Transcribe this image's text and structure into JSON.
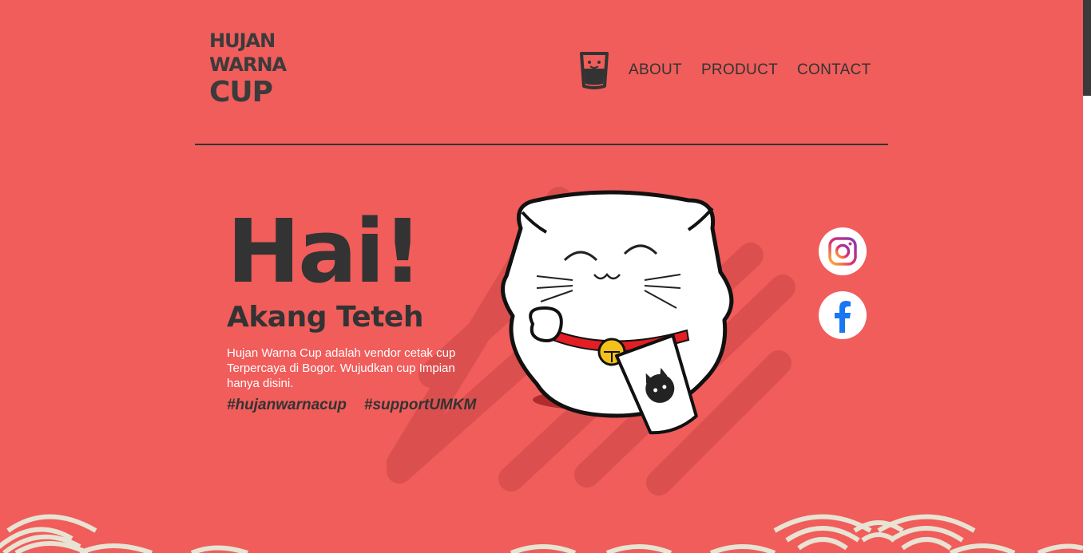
{
  "brand": {
    "logo_lines": [
      "HUJAN",
      "WARNA",
      "CUP"
    ],
    "logo_icon": "cup-icon"
  },
  "nav": {
    "icon": "cup-icon",
    "items": [
      {
        "label": "ABOUT"
      },
      {
        "label": "PRODUCT"
      },
      {
        "label": "CONTACT"
      }
    ]
  },
  "hero": {
    "title": "Hai!",
    "subtitle": "Akang Teteh",
    "description": "Hujan Warna Cup adalah vendor cetak cup Terpercaya di Bogor. Wujudkan cup Impian hanya disini.",
    "hashtags": [
      "#hujanwarnacup",
      "#supportUMKM"
    ],
    "illustration": "lucky-cat-illustration"
  },
  "social": [
    {
      "icon": "instagram-icon"
    },
    {
      "icon": "facebook-icon"
    }
  ],
  "colors": {
    "background": "#f05d5b",
    "text": "#333333",
    "accent_light": "#ffffff",
    "wave": "#e8e3d3",
    "stripe": "#d94f4d"
  }
}
